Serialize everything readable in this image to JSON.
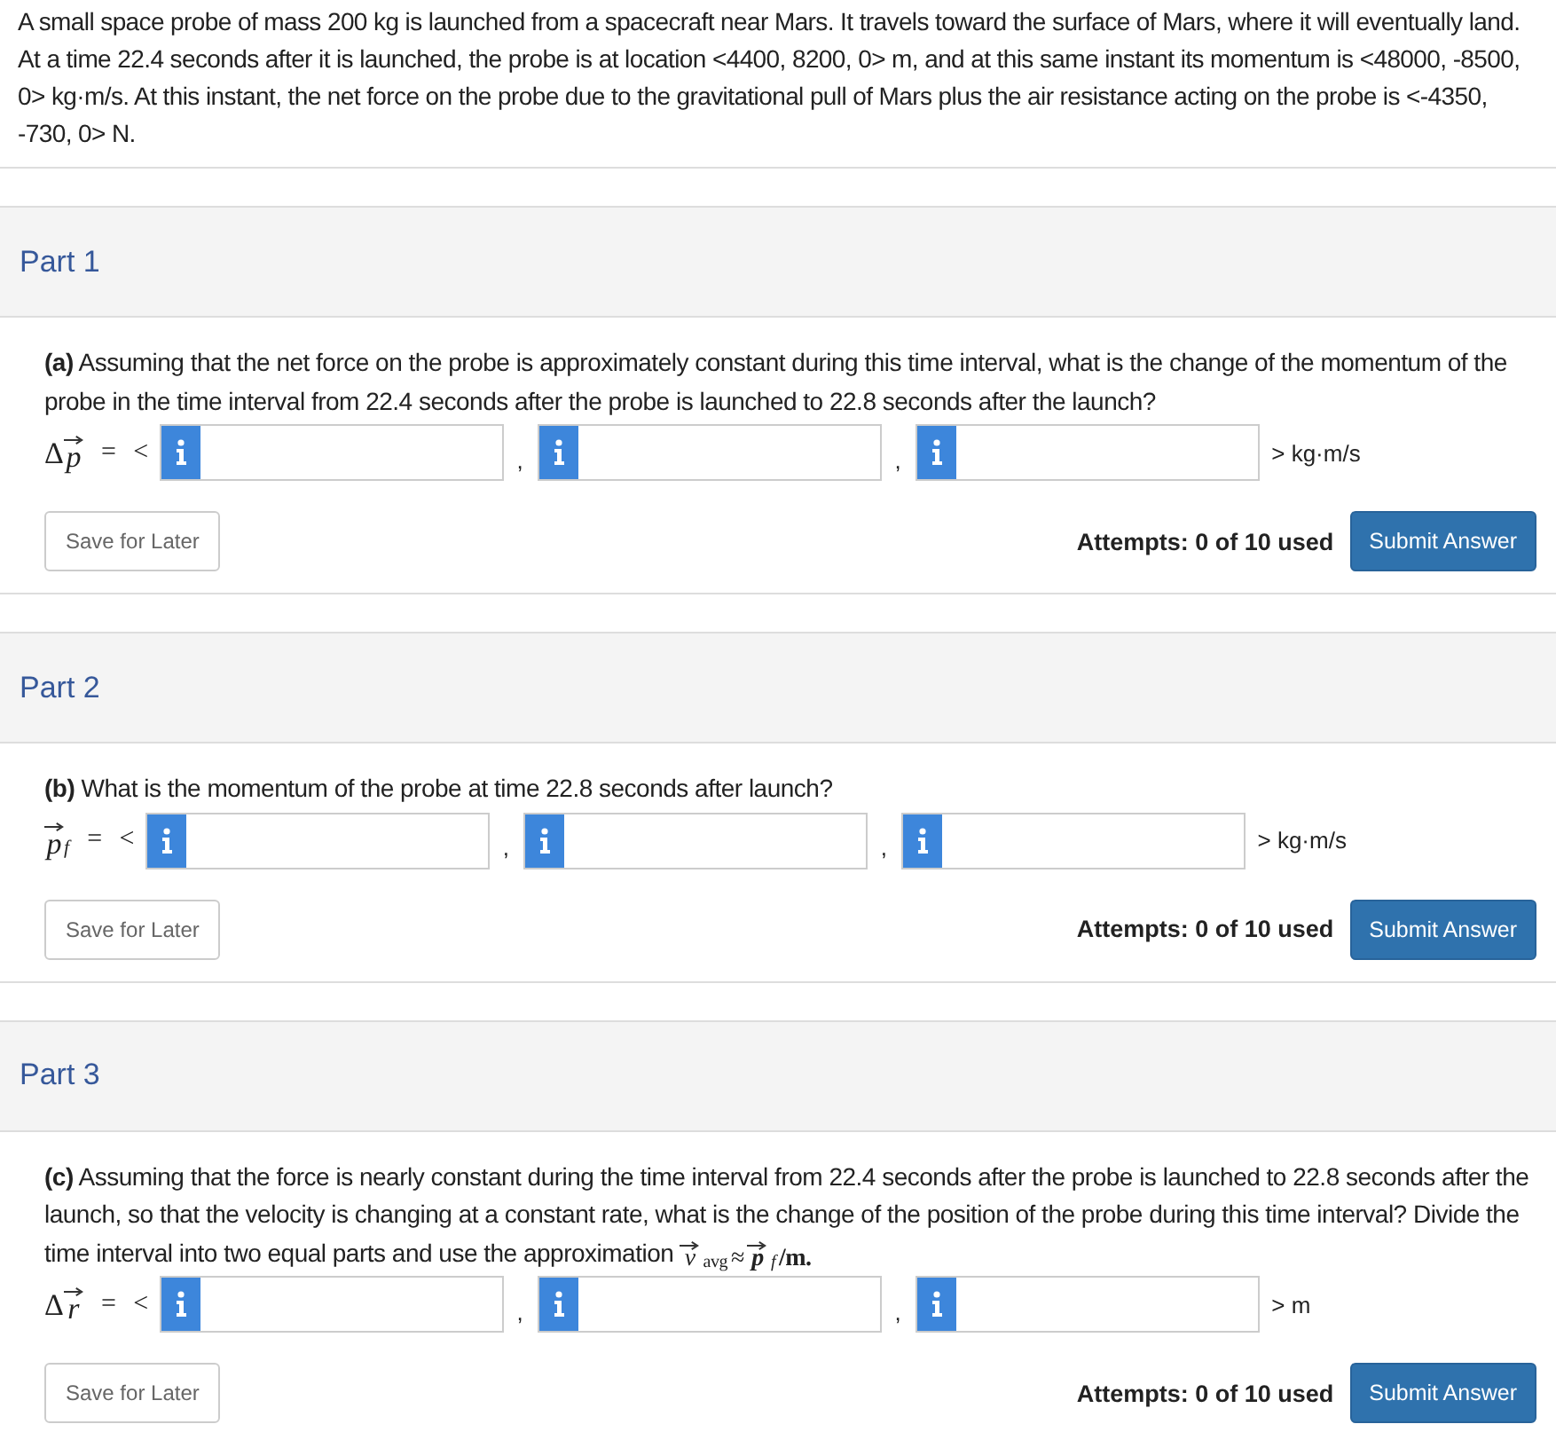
{
  "intro": "A small space probe of mass 200 kg is launched from a spacecraft near Mars. It travels toward the surface of Mars, where it will eventually land. At a time 22.4 seconds after it is launched, the probe is at location <4400, 8200, 0> m, and at this same instant its momentum is <48000, -8500, 0> kg·m/s. At this instant, the net force on the probe due to the gravitational pull of Mars plus the air resistance acting on the probe is <-4350, -730, 0> N.",
  "parts": [
    {
      "title": "Part 1",
      "question": "**(a)** Assuming that the net force on the probe is approximately constant during this time interval, what is the change of the momentum of the probe in the time interval from 22.4 seconds after the probe is launched to 22.8 seconds after the launch?",
      "lhs": {
        "prefix": "Δ",
        "vector": "p"
      },
      "eq": "= <",
      "separators": [
        ",",
        ","
      ],
      "unit": "> kg·m/s",
      "save": "Save for Later",
      "attempts": "Attempts: 0 of 10 used",
      "submit": "Submit Answer"
    },
    {
      "title": "Part 2",
      "question": "**(b)** What is the momentum of the probe at time 22.8 seconds after launch?",
      "lhs": {
        "vector": "p",
        "subscript": "f"
      },
      "eq": "= <",
      "separators": [
        ",",
        ","
      ],
      "unit": "> kg·m/s",
      "save": "Save for Later",
      "attempts": "Attempts: 0 of 10 used",
      "submit": "Submit Answer"
    },
    {
      "title": "Part 3",
      "question": "**(c)** Assuming that the force is nearly constant during the time interval from 22.4 seconds after the probe is launched to 22.8 seconds after the launch, so that the velocity is changing at a constant rate, what is the change of the position of the probe during this time interval? Divide the time interval into two equal parts and use the approximation",
      "formula": {
        "v": "v",
        "v_sub": "avg",
        "approx": "≈",
        "p": "p",
        "p_sub": "f",
        "rest": "/m."
      },
      "lhs": {
        "prefix": "Δ",
        "vector": "r"
      },
      "eq": "= <",
      "separators": [
        ",",
        ","
      ],
      "unit": "> m",
      "save": "Save for Later",
      "attempts": "Attempts: 0 of 10 used",
      "submit": "Submit Answer"
    }
  ]
}
